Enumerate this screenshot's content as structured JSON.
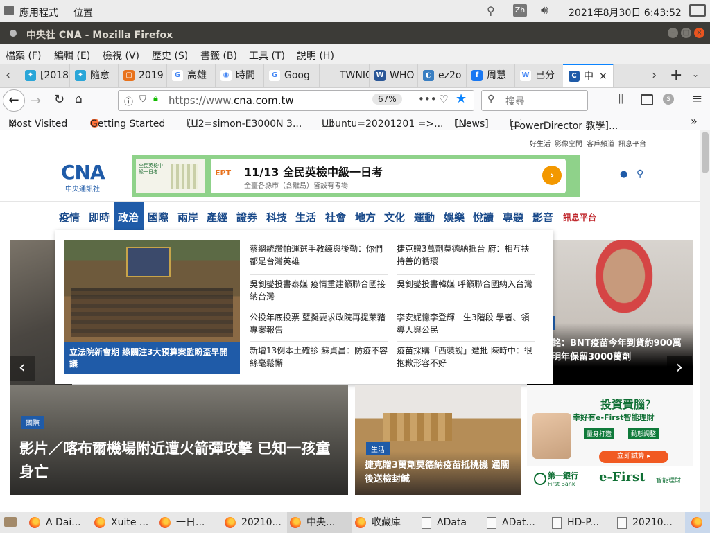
{
  "system_panel": {
    "apps_label": "應用程式",
    "places_label": "位置",
    "ime": "Zh",
    "clock": "2021年8月30日 6:43:52"
  },
  "window": {
    "title": "中央社 CNA - Mozilla Firefox"
  },
  "menu": [
    "檔案 (F)",
    "編輯 (E)",
    "檢視 (V)",
    "歷史 (S)",
    "書籤 (B)",
    "工具 (T)",
    "說明 (H)"
  ],
  "tabs": [
    {
      "label": "[2018",
      "fav_color": "#2aa6d8",
      "glyph": "✦"
    },
    {
      "label": "隨意",
      "fav_color": "#2aa6d8",
      "glyph": "✦"
    },
    {
      "label": "2019",
      "fav_color": "#e8721c",
      "glyph": "▢"
    },
    {
      "label": "高雄",
      "fav_color": "#ffffff",
      "glyph": "G"
    },
    {
      "label": "時間",
      "fav_color": "#ffffff",
      "glyph": "◉"
    },
    {
      "label": "Goog",
      "fav_color": "#ffffff",
      "glyph": "G"
    },
    {
      "label": "TWNIC",
      "fav_color": "#e3e3e3",
      "glyph": ""
    },
    {
      "label": "WHO",
      "fav_color": "#2b5797",
      "glyph": "W"
    },
    {
      "label": "ez2o",
      "fav_color": "#3a7fc2",
      "glyph": "◐"
    },
    {
      "label": "周慧",
      "fav_color": "#1877f2",
      "glyph": "f"
    },
    {
      "label": "已分",
      "fav_color": "#ffffff",
      "glyph": "W"
    },
    {
      "label": "中",
      "fav_color": "#1f5ba8",
      "glyph": "C"
    }
  ],
  "navbar": {
    "url_prefix": "https://www.",
    "url_domain": "cna.com.tw",
    "zoom": "67%",
    "search_placeholder": "搜尋"
  },
  "bookmarks": [
    {
      "label": "Most Visited",
      "type": "gear"
    },
    {
      "label": "Getting Started",
      "type": "firefox"
    },
    {
      "label": "(U2=simon-E3000N 3...",
      "type": "folder"
    },
    {
      "label": "Ubuntu=20201201 =>...",
      "type": "folder"
    },
    {
      "label": "[News]",
      "type": "folder"
    },
    {
      "label": "[PowerDirector 教學]...",
      "type": "folder"
    }
  ],
  "page": {
    "top_links": [
      "好生活",
      "影像空間",
      "客戶頻道",
      "訊息平台"
    ],
    "logo_text": "CNA",
    "logo_sub": "中央通訊社",
    "ad_banner": {
      "brand": "EPT",
      "title": "11/13 全民英檢中級一日考",
      "subtitle": "全臺各縣市（含離島）皆設有考場",
      "left_text": "全民英檢中級一日考"
    },
    "nav": [
      "疫情",
      "即時",
      "政治",
      "國際",
      "兩岸",
      "產經",
      "證券",
      "科技",
      "生活",
      "社會",
      "地方",
      "文化",
      "運動",
      "娛樂",
      "悅讀",
      "專題",
      "影音",
      "訊息平台"
    ],
    "dropdown": {
      "feature_caption": "立法院新會期 綠關注3大預算案監盼盃早開議",
      "col1": [
        "蔡總統讚帕運選手教練與後勤：你們都是台灣英雄",
        "吳釗燮投書泰媒 疫情重建籲聯合國接納台灣",
        "公投年底投票 藍擬要求政院再提萊豬專案報告",
        "新增13例本土確診 蘇貞昌：防疫不容絲毫鬆懈"
      ],
      "col2": [
        "捷克贈3萬劑莫德納抵台 府：相互扶持善的循環",
        "吳釗燮投書韓媒 呼籲聯合國納入台灣",
        "李安妮憶李登輝一生3階段 學者、領導人與公民",
        "疫苗採購「西裝說」遭批 陳時中：很抱歉形容不好"
      ]
    },
    "hero_right_caption": "銘：BNT疫苗今年到貨約900萬 明年保留3000萬劑",
    "main_story": {
      "badge": "國際",
      "title": "影片／喀布爾機場附近遭火箭彈攻擊 已知一孩童身亡"
    },
    "story2": {
      "badge": "生活",
      "title": "捷克贈3萬劑莫德納疫苗抵桃機 通關後送檢封緘"
    },
    "ad_right": {
      "title": "投資費腦？",
      "subtitle": "幸好有e-First智能理財",
      "tag1": "量身打造",
      "tag2": "動態調整",
      "cta": "立即試算 ▸",
      "bank": "第一銀行",
      "bank_en": "First Bank",
      "brand": "e-First",
      "brand_sub": "智能理財"
    }
  },
  "taskbar": [
    {
      "label": "A Dai...",
      "icon": "ff"
    },
    {
      "label": "Xuite ...",
      "icon": "ff"
    },
    {
      "label": "一日...",
      "icon": "ff"
    },
    {
      "label": "20210...",
      "icon": "ff"
    },
    {
      "label": "中央...",
      "icon": "ff"
    },
    {
      "label": "收藏庫",
      "icon": "ff"
    },
    {
      "label": "AData",
      "icon": "doc"
    },
    {
      "label": "ADat...",
      "icon": "doc"
    },
    {
      "label": "HD-P...",
      "icon": "doc"
    },
    {
      "label": "20210...",
      "icon": "doc"
    }
  ]
}
